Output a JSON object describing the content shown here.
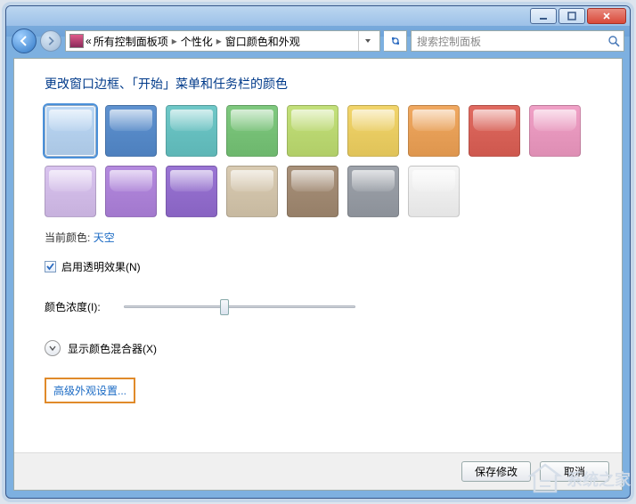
{
  "titlebar": {
    "minimize": "minimize",
    "maximize": "maximize",
    "close": "close"
  },
  "nav": {
    "breadcrumb_prefix": "«",
    "crumbs": [
      "所有控制面板项",
      "个性化",
      "窗口颜色和外观"
    ],
    "search_placeholder": "搜索控制面板"
  },
  "main": {
    "heading": "更改窗口边框、「开始」菜单和任务栏的颜色",
    "swatches": [
      {
        "name": "sky",
        "color": "#bcd8f5",
        "selected": true
      },
      {
        "name": "blue",
        "color": "#5f92d0"
      },
      {
        "name": "teal",
        "color": "#6fc8c8"
      },
      {
        "name": "green",
        "color": "#7fc97f"
      },
      {
        "name": "lime",
        "color": "#c3e07a"
      },
      {
        "name": "yellow",
        "color": "#f2d56b"
      },
      {
        "name": "orange",
        "color": "#f0a860"
      },
      {
        "name": "red",
        "color": "#e06a60"
      },
      {
        "name": "pink",
        "color": "#f0a0c6"
      },
      {
        "name": "lavender",
        "color": "#d9c3ef"
      },
      {
        "name": "purple",
        "color": "#b48adf"
      },
      {
        "name": "violet",
        "color": "#9a75d4"
      },
      {
        "name": "tan",
        "color": "#d9cbb2"
      },
      {
        "name": "taupe",
        "color": "#a8917a"
      },
      {
        "name": "gray",
        "color": "#9ea3ab"
      },
      {
        "name": "white",
        "color": "#f6f6f6"
      }
    ],
    "current_label": "当前颜色:",
    "current_value": "天空",
    "transparency_checkbox": {
      "label": "启用透明效果(N)",
      "checked": true
    },
    "intensity_label": "颜色浓度(I):",
    "intensity_value": 42,
    "mixer_expander": "显示颜色混合器(X)",
    "advanced_link": "高级外观设置..."
  },
  "footer": {
    "save": "保存修改",
    "cancel": "取消"
  },
  "watermark": "系统之家"
}
